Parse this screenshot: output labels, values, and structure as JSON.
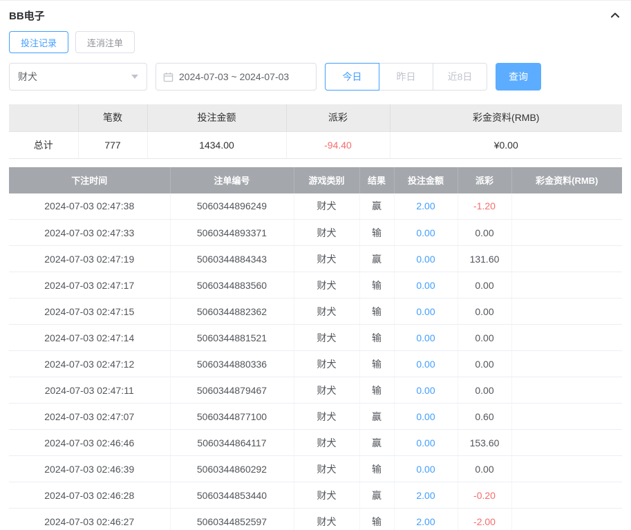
{
  "colors": {
    "accent": "#409eff",
    "danger": "#f56c6c",
    "search_button": "#5cadff",
    "table_header_bg": "#a4a7ac"
  },
  "header": {
    "title": "BB电子",
    "collapse_icon": "chevron-up"
  },
  "tabs": [
    {
      "label": "投注记录",
      "active": true
    },
    {
      "label": "连消注单",
      "active": false
    }
  ],
  "filters": {
    "game_select": {
      "value": "财犬",
      "icon": "chevron-down"
    },
    "date_range": {
      "value": "2024-07-03 ~ 2024-07-03",
      "icon": "calendar"
    },
    "quick_buttons": [
      {
        "label": "今日",
        "active": true
      },
      {
        "label": "昨日",
        "active": false
      },
      {
        "label": "近8日",
        "active": false
      }
    ],
    "search_label": "查询"
  },
  "summary": {
    "headers": [
      "",
      "笔数",
      "投注金额",
      "派彩",
      "彩金资料(RMB)"
    ],
    "total_label": "总计",
    "count": "777",
    "bet_amount": "1434.00",
    "payout": "-94.40",
    "bonus": "¥0.00"
  },
  "table": {
    "headers": [
      "下注时间",
      "注单编号",
      "游戏类别",
      "结果",
      "投注金额",
      "派彩",
      "彩金资料(RMB)"
    ],
    "rows": [
      {
        "time": "2024-07-03 02:47:38",
        "order_id": "5060344896249",
        "game": "财犬",
        "result": "赢",
        "bet": "2.00",
        "payout": "-1.20",
        "bonus": ""
      },
      {
        "time": "2024-07-03 02:47:33",
        "order_id": "5060344893371",
        "game": "财犬",
        "result": "输",
        "bet": "0.00",
        "payout": "0.00",
        "bonus": ""
      },
      {
        "time": "2024-07-03 02:47:19",
        "order_id": "5060344884343",
        "game": "财犬",
        "result": "赢",
        "bet": "0.00",
        "payout": "131.60",
        "bonus": ""
      },
      {
        "time": "2024-07-03 02:47:17",
        "order_id": "5060344883560",
        "game": "财犬",
        "result": "输",
        "bet": "0.00",
        "payout": "0.00",
        "bonus": ""
      },
      {
        "time": "2024-07-03 02:47:15",
        "order_id": "5060344882362",
        "game": "财犬",
        "result": "输",
        "bet": "0.00",
        "payout": "0.00",
        "bonus": ""
      },
      {
        "time": "2024-07-03 02:47:14",
        "order_id": "5060344881521",
        "game": "财犬",
        "result": "输",
        "bet": "0.00",
        "payout": "0.00",
        "bonus": ""
      },
      {
        "time": "2024-07-03 02:47:12",
        "order_id": "5060344880336",
        "game": "财犬",
        "result": "输",
        "bet": "0.00",
        "payout": "0.00",
        "bonus": ""
      },
      {
        "time": "2024-07-03 02:47:11",
        "order_id": "5060344879467",
        "game": "财犬",
        "result": "输",
        "bet": "0.00",
        "payout": "0.00",
        "bonus": ""
      },
      {
        "time": "2024-07-03 02:47:07",
        "order_id": "5060344877100",
        "game": "财犬",
        "result": "赢",
        "bet": "0.00",
        "payout": "0.60",
        "bonus": ""
      },
      {
        "time": "2024-07-03 02:46:46",
        "order_id": "5060344864117",
        "game": "财犬",
        "result": "赢",
        "bet": "0.00",
        "payout": "153.60",
        "bonus": ""
      },
      {
        "time": "2024-07-03 02:46:39",
        "order_id": "5060344860292",
        "game": "财犬",
        "result": "输",
        "bet": "0.00",
        "payout": "0.00",
        "bonus": ""
      },
      {
        "time": "2024-07-03 02:46:28",
        "order_id": "5060344853440",
        "game": "财犬",
        "result": "赢",
        "bet": "2.00",
        "payout": "-0.20",
        "bonus": ""
      },
      {
        "time": "2024-07-03 02:46:27",
        "order_id": "5060344852597",
        "game": "财犬",
        "result": "输",
        "bet": "2.00",
        "payout": "-2.00",
        "bonus": ""
      }
    ]
  }
}
